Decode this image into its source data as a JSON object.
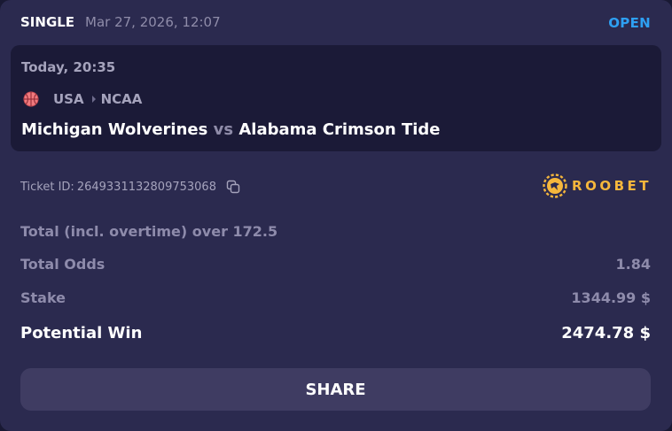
{
  "header": {
    "bet_type": "SINGLE",
    "placed_date": "Mar 27, 2026, 12:07",
    "status": "OPEN",
    "status_color": "#2ea0f3"
  },
  "event": {
    "time": "Today, 20:35",
    "sport_icon": "basketball-icon",
    "country": "USA",
    "league": "NCAA",
    "home_team": "Michigan Wolverines",
    "vs": "vs",
    "away_team": "Alabama Crimson Tide"
  },
  "ticket": {
    "label": "Ticket ID:",
    "id": "2649331132809753068",
    "copy_icon": "copy-icon"
  },
  "brand": {
    "name": "ROOBET",
    "color": "#f6b73c"
  },
  "selection": {
    "text": "Total (incl. overtime) over 172.5"
  },
  "summary": {
    "odds_label": "Total Odds",
    "odds_value": "1.84",
    "stake_label": "Stake",
    "stake_value": "1344.99 $",
    "win_label": "Potential Win",
    "win_value": "2474.78 $"
  },
  "actions": {
    "share_label": "SHARE"
  }
}
